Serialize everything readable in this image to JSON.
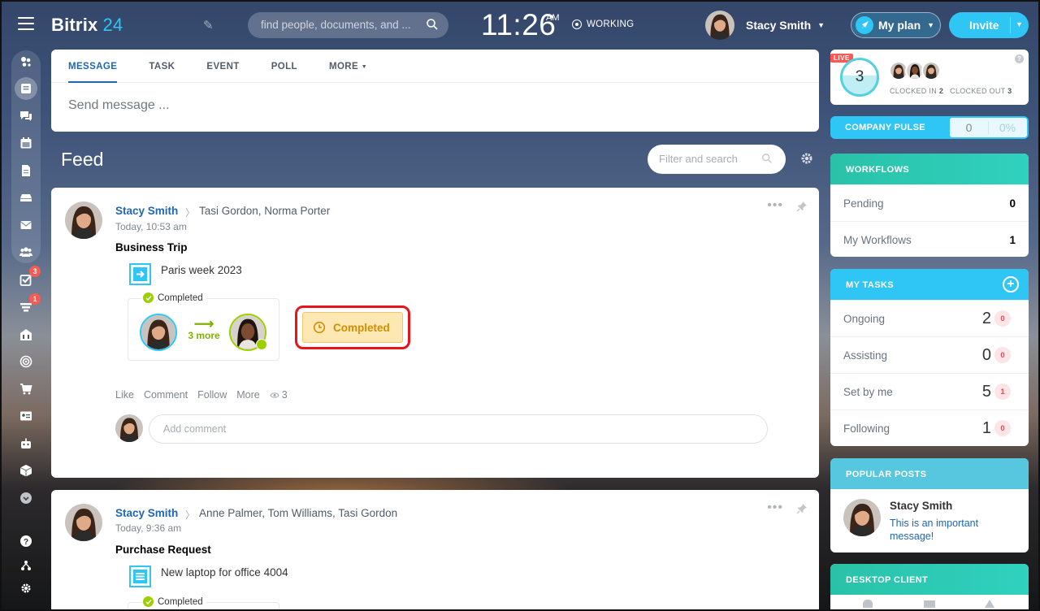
{
  "app": {
    "logo_name": "Bitrix",
    "logo_num": "24"
  },
  "search": {
    "placeholder": "find people, documents, and ..."
  },
  "clock": {
    "time": "11:26",
    "ampm": "AM"
  },
  "work_status": "WORKING",
  "user": {
    "name": "Stacy Smith"
  },
  "myplan_label": "My plan",
  "invite_label": "Invite",
  "sidebar": {
    "badges": {
      "tasks": "3",
      "crm": "1"
    }
  },
  "composer": {
    "tabs": [
      "MESSAGE",
      "TASK",
      "EVENT",
      "POLL",
      "MORE"
    ],
    "placeholder": "Send message ..."
  },
  "feed": {
    "title": "Feed",
    "filter_placeholder": "Filter and search"
  },
  "posts": [
    {
      "author": "Stacy Smith",
      "recipients": "Tasi Gordon, Norma Porter",
      "time": "Today, 10:53 am",
      "title": "Business Trip",
      "subject": "Paris week 2023",
      "approval_status": "Completed",
      "more_label": "3 more",
      "status_button": "Completed",
      "actions": {
        "like": "Like",
        "comment": "Comment",
        "follow": "Follow",
        "more": "More",
        "views": "3"
      },
      "comment_placeholder": "Add comment"
    },
    {
      "author": "Stacy Smith",
      "recipients": "Anne Palmer, Tom Williams, Tasi Gordon",
      "time": "Today, 9:36 am",
      "title": "Purchase Request",
      "subject": "New laptop for office 4004",
      "approval_status": "Completed"
    }
  ],
  "live": {
    "badge": "LIVE",
    "count": "3",
    "clocked_in_label": "CLOCKED IN",
    "clocked_in": "2",
    "clocked_out_label": "CLOCKED OUT",
    "clocked_out": "3"
  },
  "pulse": {
    "label": "COMPANY PULSE",
    "value": "0",
    "percent": "0%"
  },
  "workflows": {
    "title": "WORKFLOWS",
    "rows": [
      {
        "label": "Pending",
        "count": "0"
      },
      {
        "label": "My Workflows",
        "count": "1"
      }
    ]
  },
  "tasks": {
    "title": "MY TASKS",
    "rows": [
      {
        "label": "Ongoing",
        "count": "2",
        "overdue": "0"
      },
      {
        "label": "Assisting",
        "count": "0",
        "overdue": "0"
      },
      {
        "label": "Set by me",
        "count": "5",
        "overdue": "1"
      },
      {
        "label": "Following",
        "count": "1",
        "overdue": "0"
      }
    ]
  },
  "popular": {
    "title": "POPULAR POSTS",
    "author": "Stacy Smith",
    "message": "This is an important message!"
  },
  "desktop": {
    "title": "DESKTOP CLIENT"
  },
  "colors": {
    "accent": "#2fc6f6",
    "link": "#2067b0",
    "completed": "#d18f00",
    "highlight": "#e8141a"
  }
}
